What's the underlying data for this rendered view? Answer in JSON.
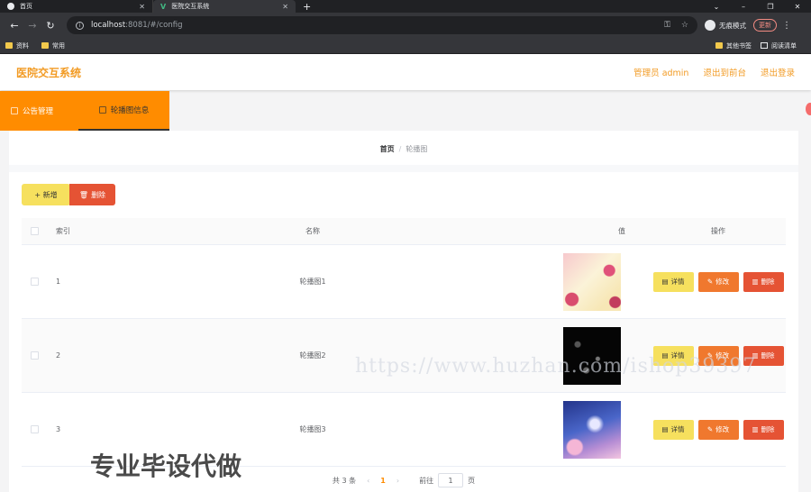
{
  "browser": {
    "tabs": [
      {
        "title": "首页",
        "active": false
      },
      {
        "title": "医院交互系统",
        "active": true
      }
    ],
    "new_tab": "+",
    "address": {
      "host": "localhost",
      "path": ":8081/#/config"
    },
    "profile_label": "无痕模式",
    "update_label": "更新",
    "bookmarks_left": [
      "资料",
      "常用"
    ],
    "bookmarks_right": [
      "其他书签",
      "阅读清单"
    ]
  },
  "app": {
    "title": "医院交互系统",
    "user_label": "管理员 admin",
    "back_label": "退出到前台",
    "logout_label": "退出登录"
  },
  "menu": {
    "items": [
      {
        "label": "公告管理",
        "active": false
      },
      {
        "label": "轮播图信息",
        "active": true
      }
    ]
  },
  "breadcrumb": {
    "home": "首页",
    "separator": "/",
    "current": "轮播图"
  },
  "toolbar": {
    "add_label": "+ 新增",
    "delete_label": "删除"
  },
  "table": {
    "headers": {
      "index": "索引",
      "name": "名称",
      "value": "值",
      "ops": "操作"
    },
    "rows": [
      {
        "index": "1",
        "name": "轮播图1",
        "image": "pink-floral"
      },
      {
        "index": "2",
        "name": "轮播图2",
        "image": "dark-night"
      },
      {
        "index": "3",
        "name": "轮播图3",
        "image": "blue-sky"
      }
    ],
    "ops": {
      "detail": "详情",
      "edit": "修改",
      "delete": "删除"
    }
  },
  "pagination": {
    "total": "共 3 条",
    "current_page": "1",
    "goto_label": "前往",
    "goto_value": "1",
    "page_unit": "页"
  },
  "overlays": {
    "watermark": "https://www.huzhan.com/ishop39397",
    "promo": "专业毕设代做"
  },
  "colors": {
    "accent": "#ff8c00",
    "title": "#f29b24",
    "detail": "#f6e05e",
    "edit": "#f0782e",
    "delete": "#e55334"
  }
}
